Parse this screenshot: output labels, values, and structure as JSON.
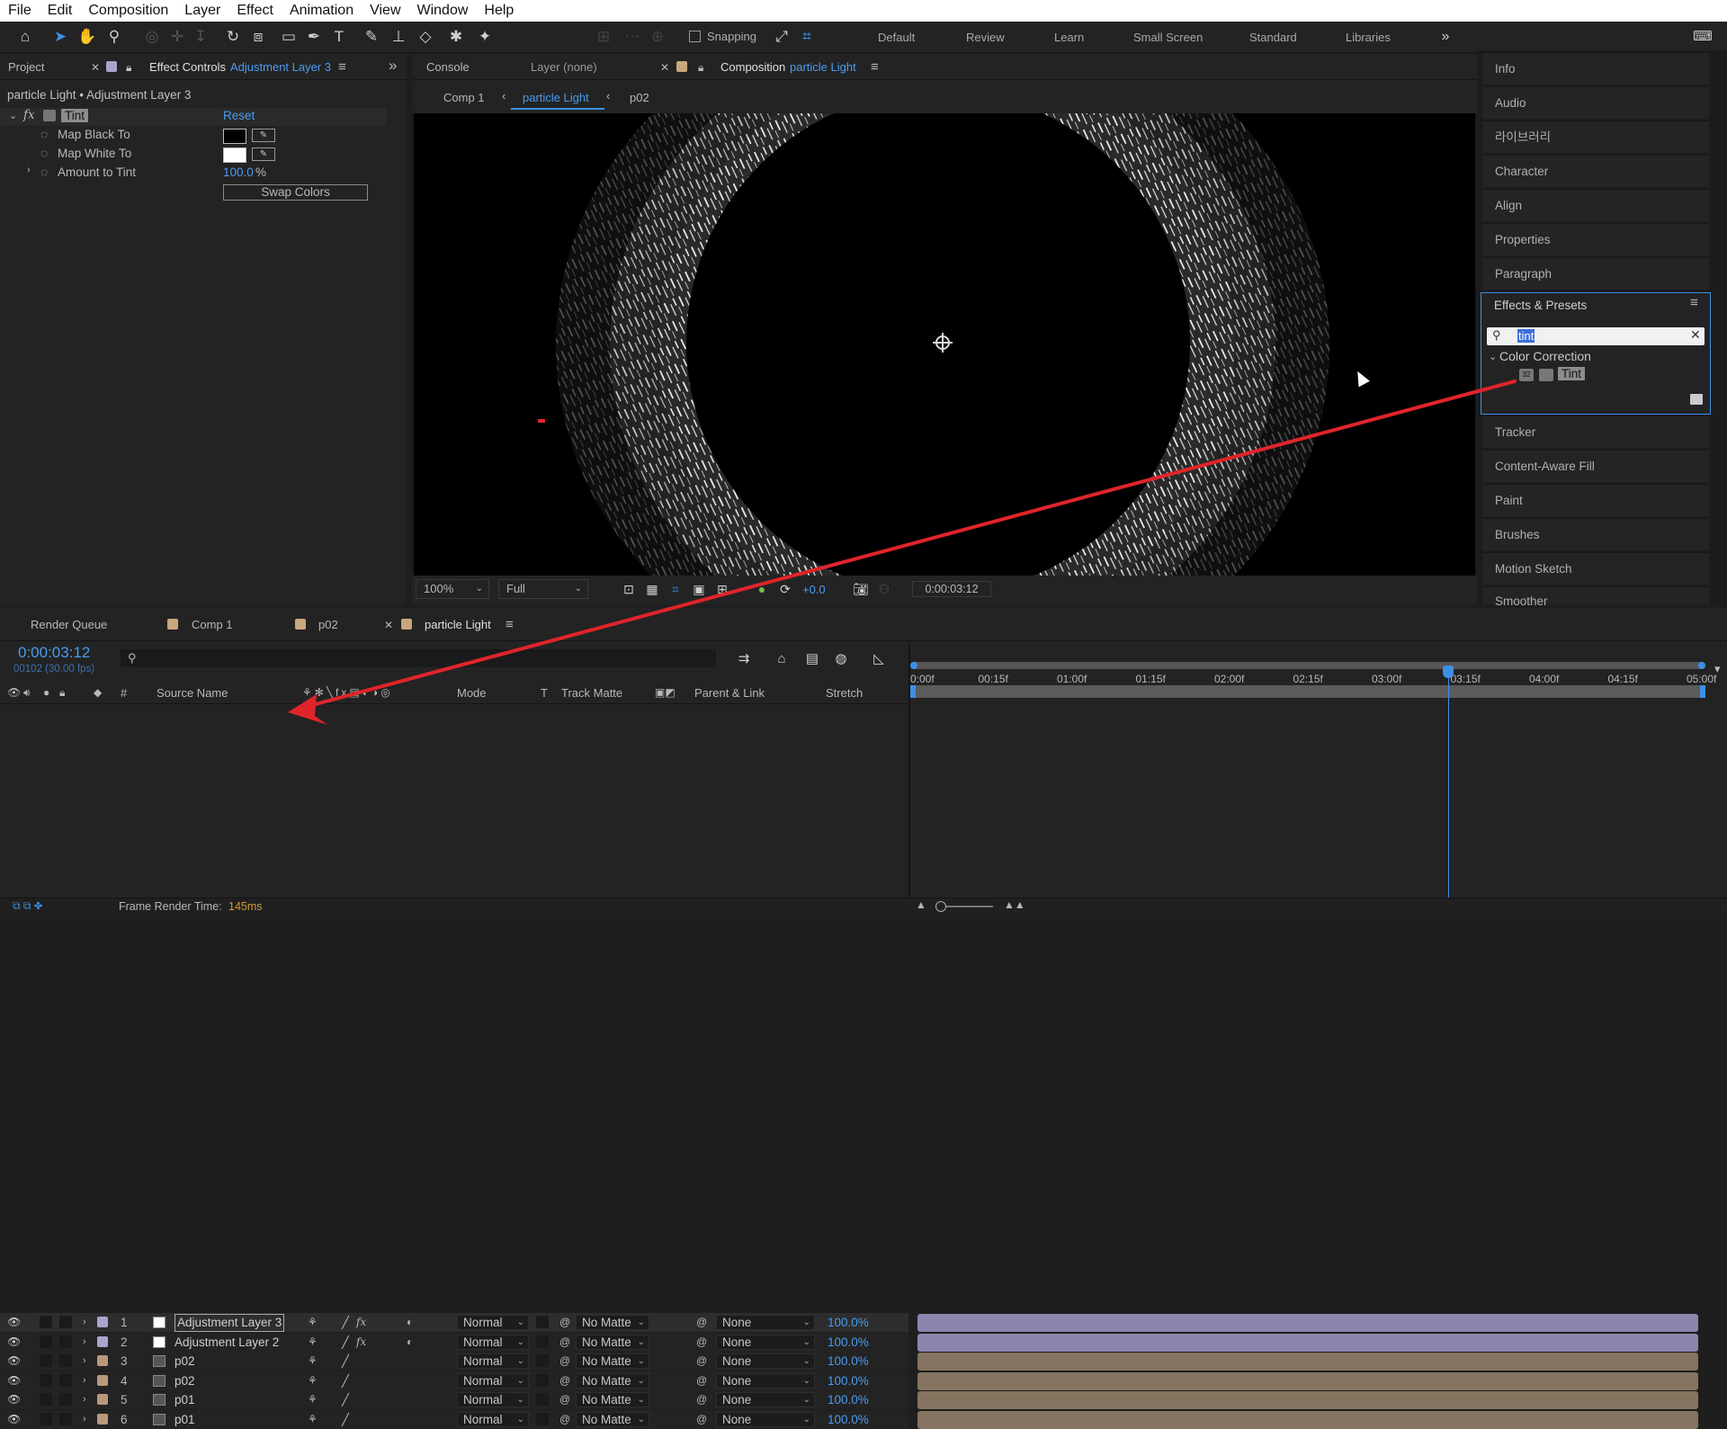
{
  "menu": [
    "File",
    "Edit",
    "Composition",
    "Layer",
    "Effect",
    "Animation",
    "View",
    "Window",
    "Help"
  ],
  "toolbar": {
    "snapping_label": "Snapping",
    "workspaces": [
      "Default",
      "Review",
      "Learn",
      "Small Screen",
      "Standard",
      "Libraries"
    ]
  },
  "effect_controls": {
    "project_tab": "Project",
    "tab_label": "Effect Controls",
    "tab_target": "Adjustment Layer 3",
    "breadcrumb": "particle Light • Adjustment Layer 3",
    "effect_name": "Tint",
    "reset_label": "Reset",
    "props": [
      {
        "label": "Map Black To"
      },
      {
        "label": "Map White To"
      },
      {
        "label": "Amount to Tint",
        "value": "100.0",
        "unit": "%"
      }
    ],
    "swap_label": "Swap Colors"
  },
  "composition": {
    "console_tab": "Console",
    "layer_tab": "Layer (none)",
    "comp_tab_label": "Composition",
    "comp_tab_name": "particle Light",
    "breadcrumbs": [
      "Comp 1",
      "particle Light",
      "p02"
    ],
    "zoom": "100%",
    "resolution": "Full",
    "exposure": "+0.0",
    "timecode": "0:00:03:12"
  },
  "right_panels": {
    "top": [
      "Info",
      "Audio",
      "라이브러리",
      "Character",
      "Align",
      "Properties",
      "Paragraph"
    ],
    "effects_title": "Effects & Presets",
    "search_value": "tint",
    "category": "Color Correction",
    "result": "Tint",
    "bottom": [
      "Tracker",
      "Content-Aware Fill",
      "Paint",
      "Brushes",
      "Motion Sketch",
      "Smoother"
    ]
  },
  "timeline": {
    "tabs": [
      "Render Queue",
      "Comp 1",
      "p02",
      "particle Light"
    ],
    "timecode": "0:00:03:12",
    "frame_info": "00102 (30.00 fps)",
    "columns": {
      "num": "#",
      "source": "Source Name",
      "mode": "Mode",
      "t": "T",
      "matte": "Track Matte",
      "parent": "Parent & Link",
      "stretch": "Stretch"
    },
    "ruler": [
      "0:00f",
      "00:15f",
      "01:00f",
      "01:15f",
      "02:00f",
      "02:15f",
      "03:00f",
      "03:15f",
      "04:00f",
      "04:15f",
      "05:00f"
    ],
    "layers": [
      {
        "num": "1",
        "name": "Adjustment Layer 3",
        "mode": "Normal",
        "matte": "No Matte",
        "parent": "None",
        "stretch": "100.0%",
        "color": "#a9a4d0"
      },
      {
        "num": "2",
        "name": "Adjustment Layer 2",
        "mode": "Normal",
        "matte": "No Matte",
        "parent": "None",
        "stretch": "100.0%",
        "color": "#a9a4d0"
      },
      {
        "num": "3",
        "name": "p02",
        "mode": "Normal",
        "matte": "No Matte",
        "parent": "None",
        "stretch": "100.0%",
        "color": "#b8997a"
      },
      {
        "num": "4",
        "name": "p02",
        "mode": "Normal",
        "matte": "No Matte",
        "parent": "None",
        "stretch": "100.0%",
        "color": "#b8997a"
      },
      {
        "num": "5",
        "name": "p01",
        "mode": "Normal",
        "matte": "No Matte",
        "parent": "None",
        "stretch": "100.0%",
        "color": "#b8997a"
      },
      {
        "num": "6",
        "name": "p01",
        "mode": "Normal",
        "matte": "No Matte",
        "parent": "None",
        "stretch": "100.0%",
        "color": "#b8997a"
      }
    ],
    "status_label": "Frame Render Time:",
    "status_value": "145ms"
  }
}
